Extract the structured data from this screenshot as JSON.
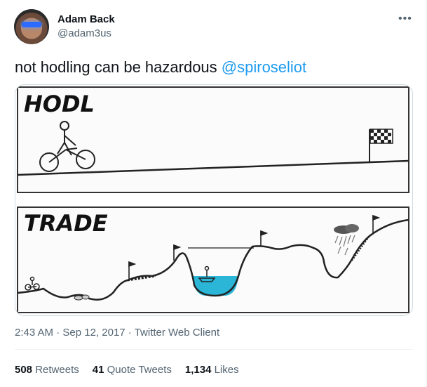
{
  "author": {
    "name": "Adam Back",
    "handle": "@adam3us"
  },
  "menu_icon": "more-horizontal-icon",
  "tweet": {
    "text_prefix": "not hodling can be hazardous ",
    "mention": "@spiroseliot"
  },
  "image": {
    "panel1_title": "HODL",
    "panel2_title": "TRADE"
  },
  "meta": {
    "time": "2:43 AM",
    "sep1": " · ",
    "date": "Sep 12, 2017",
    "sep2": " · ",
    "client": "Twitter Web Client"
  },
  "stats": {
    "retweets_count": "508",
    "retweets_label": "Retweets",
    "quotes_count": "41",
    "quotes_label": "Quote Tweets",
    "likes_count": "1,134",
    "likes_label": "Likes"
  },
  "colors": {
    "link": "#1d9bf0",
    "secondary_text": "#536471",
    "water": "#2bb6d8"
  }
}
